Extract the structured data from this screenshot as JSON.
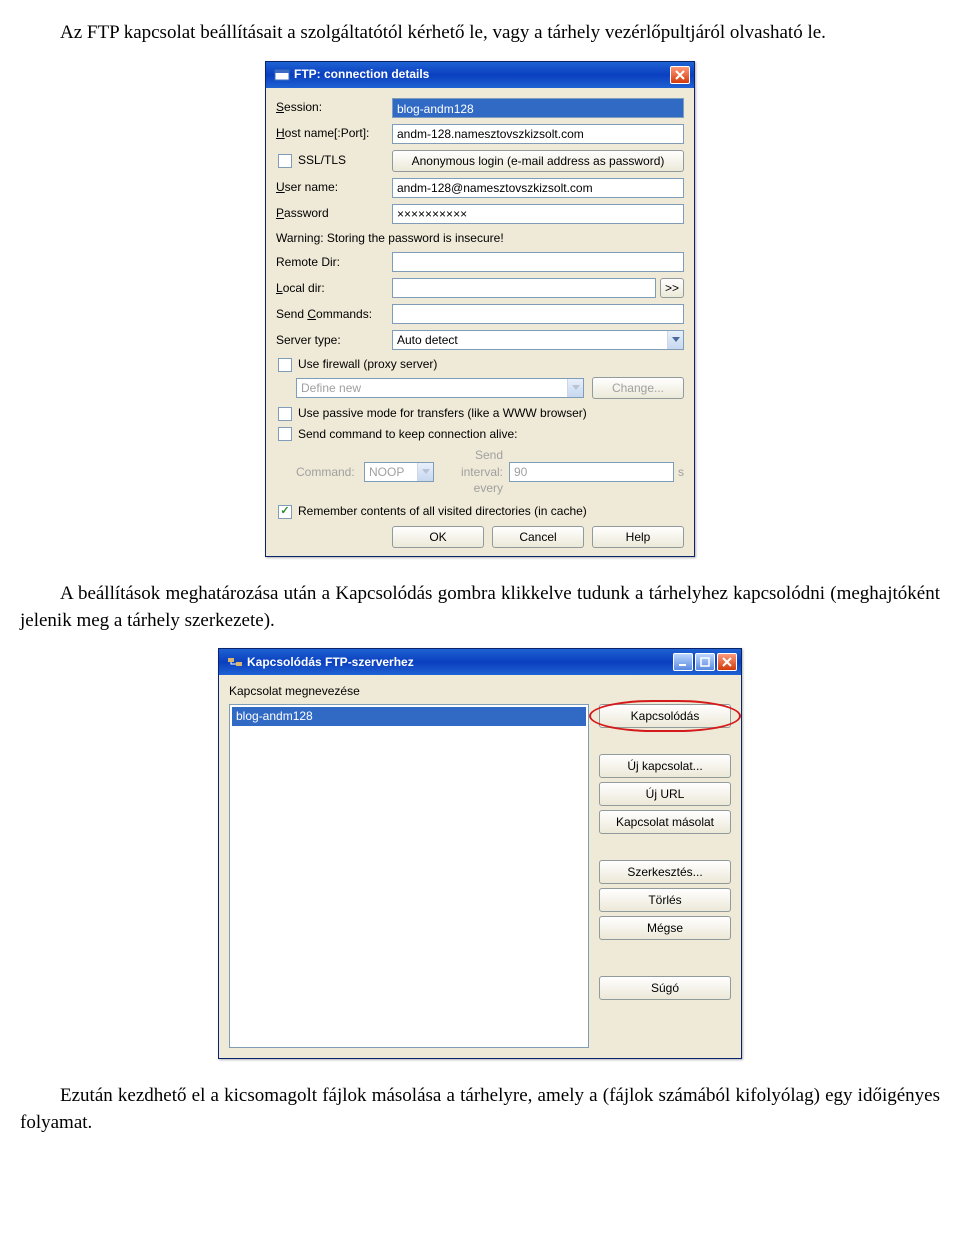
{
  "paragraphs": {
    "p1": "Az FTP kapcsolat beállításait a szolgáltatótól kérhető le, vagy a tárhely vezérlőpultjáról olvasható le.",
    "p2": "A beállítások meghatározása után a Kapcsolódás gombra klikkelve tudunk a tárhelyhez kapcsolódni (meghajtóként jelenik meg a tárhely szerkezete).",
    "p3": "Ezután kezdhető el a kicsomagolt fájlok másolása a tárhelyre, amely a (fájlok számából kifolyólag) egy időigényes folyamat."
  },
  "dlg1": {
    "title": "FTP: connection details",
    "labels": {
      "session": "Session:",
      "host": "Host name[:Port]:",
      "ssl": "SSL/TLS",
      "anon_btn": "Anonymous login (e-mail address as password)",
      "user": "User name:",
      "password": "Password",
      "warning": "Warning: Storing the password is insecure!",
      "remote": "Remote Dir:",
      "local": "Local dir:",
      "sendcmd": "Send Commands:",
      "servertype": "Server type:",
      "use_firewall": "Use firewall (proxy server)",
      "firewall_option": "Define new",
      "change": "Change...",
      "use_passive": "Use passive mode for transfers (like a WWW browser)",
      "keepalive": "Send command to keep connection alive:",
      "command": "Command:",
      "noop": "NOOP",
      "interval_label": "Send interval: every",
      "interval_val": "90",
      "interval_unit": "s",
      "remember": "Remember contents of all visited directories (in cache)",
      "local_browse": ">>"
    },
    "values": {
      "session": "blog-andm128",
      "host": "andm-128.namesztovszkizsolt.com",
      "user": "andm-128@namesztovszkizsolt.com",
      "password": "××××××××××",
      "remote": "",
      "local": "",
      "sendcmd": "",
      "servertype": "Auto detect"
    },
    "buttons": {
      "ok": "OK",
      "cancel": "Cancel",
      "help": "Help"
    }
  },
  "dlg2": {
    "title": "Kapcsolódás FTP-szerverhez",
    "listlabel": "Kapcsolat megnevezése",
    "item": "blog-andm128",
    "buttons": {
      "connect": "Kapcsolódás",
      "new_conn": "Új kapcsolat...",
      "new_url": "Új URL",
      "copy_conn": "Kapcsolat másolat",
      "edit": "Szerkesztés...",
      "delete": "Törlés",
      "cancel": "Mégse",
      "help": "Súgó"
    }
  }
}
